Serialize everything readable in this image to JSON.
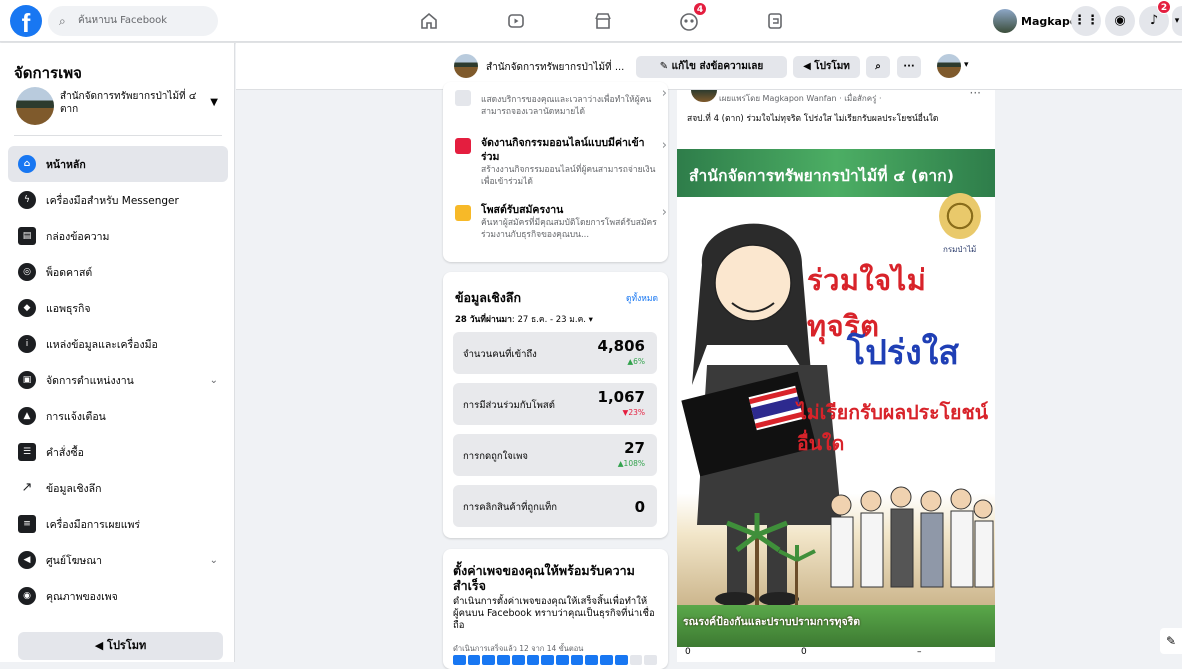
{
  "topbar": {
    "search_placeholder": "ค้นหาบน Facebook",
    "notifications": {
      "groups_badge": "4",
      "alerts_badge": "2"
    },
    "profile_name": "Magkapon"
  },
  "sidebar": {
    "heading": "จัดการเพจ",
    "page_name": "สำนักจัดการทรัพยากรป่าไม้ที่ ๔ ตาก",
    "items": [
      {
        "label": "หน้าหลัก",
        "icon": "home-icon"
      },
      {
        "label": "เครื่องมือสำหรับ Messenger",
        "icon": "messenger-icon"
      },
      {
        "label": "กล่องข้อความ",
        "icon": "inbox-icon"
      },
      {
        "label": "พ็อดคาสต์",
        "icon": "podcast-icon"
      },
      {
        "label": "แอพธุรกิจ",
        "icon": "cube-icon"
      },
      {
        "label": "แหล่งข้อมูลและเครื่องมือ",
        "icon": "info-icon"
      },
      {
        "label": "จัดการตำแหน่งงาน",
        "icon": "briefcase-icon"
      },
      {
        "label": "การแจ้งเตือน",
        "icon": "bell-icon"
      },
      {
        "label": "คำสั่งซื้อ",
        "icon": "orders-icon"
      },
      {
        "label": "ข้อมูลเชิงลึก",
        "icon": "insights-icon"
      },
      {
        "label": "เครื่องมือการเผยแพร่",
        "icon": "publishing-icon"
      },
      {
        "label": "ศูนย์โฆษณา",
        "icon": "megaphone-icon"
      },
      {
        "label": "คุณภาพของเพจ",
        "icon": "shield-icon"
      }
    ],
    "promote_label": "โปรโมท"
  },
  "subbar": {
    "title": "สำนักจัดการทรัพยากรป่าไม้ที่ ...",
    "edit_label": "แก้ไข ส่งข้อความเลย",
    "promote_label": "โปรโมท"
  },
  "actions": [
    {
      "title": "",
      "desc": "แสดงบริการของคุณและเวลาว่างเพื่อทำให้ผู้คนสามารถจองเวลานัดหมายได้"
    },
    {
      "title": "จัดงานกิจกรรมออนไลน์แบบมีค่าเข้าร่วม",
      "desc": "สร้างงานกิจกรรมออนไลน์ที่ผู้คนสามารถจ่ายเงินเพื่อเข้าร่วมได้"
    },
    {
      "title": "โพสต์รับสมัครงาน",
      "desc": "ค้นหาผู้สมัครที่มีคุณสมบัติโดยการโพสต์รับสมัครร่วมงานกับธุรกิจของคุณบน..."
    }
  ],
  "insights": {
    "heading": "ข้อมูลเชิงลึก",
    "see_all": "ดูทั้งหมด",
    "range_label": "28 วันที่ผ่านมา",
    "range": ": 27 ธ.ค. - 23 ม.ค.",
    "stats": [
      {
        "label": "จำนวนคนที่เข้าถึง",
        "value": "4,806",
        "change": "▲6%",
        "dir": "up"
      },
      {
        "label": "การมีส่วนร่วมกับโพสต์",
        "value": "1,067",
        "change": "▼23%",
        "dir": "down"
      },
      {
        "label": "การกดถูกใจเพจ",
        "value": "27",
        "change": "▲108%",
        "dir": "up"
      },
      {
        "label": "การคลิกสินค้าที่ถูกแท็ก",
        "value": "0",
        "change": "",
        "dir": ""
      }
    ]
  },
  "setup": {
    "heading": "ตั้งค่าเพจของคุณให้พร้อมรับความสำเร็จ",
    "desc": "ดำเนินการตั้งค่าเพจของคุณให้เสร็จสิ้นเพื่อทำให้ผู้คนบน Facebook ทราบว่าคุณเป็นธุรกิจที่น่าเชื่อถือ",
    "progress_text": "ดำเนินการเสร็จแล้ว 12 จาก 14 ขั้นตอน",
    "progress_done": 12,
    "progress_total": 14
  },
  "post": {
    "meta": "เผยแพร่โดย Magkapon Wanfan · เมื่อสักครู่ ·",
    "text": "สจป.ที่ 4 (ตาก) ร่วมใจไม่ทุจริต โปร่งใส ไม่เรียกรับผลประโยชน์อื่นใด",
    "poster_title": "สำนักจัดการทรัพยากรป่าไม้ที่ ๔ (ตาก)",
    "seal_label": "กรมป่าไม้",
    "line1": "ร่วมใจไม่ทุจริต",
    "line2": "โปร่งใส",
    "line3": "ไม่เรียกรับผลประโยชน์อื่นใด",
    "footer": "รณรงค์ป้องกันและปราบปรามการทุจริต",
    "stat_a": "0",
    "stat_b": "0",
    "stat_c": "–"
  },
  "colors": {
    "brand": "#1877f2",
    "up": "#31a24c",
    "down": "#e41e3f"
  }
}
